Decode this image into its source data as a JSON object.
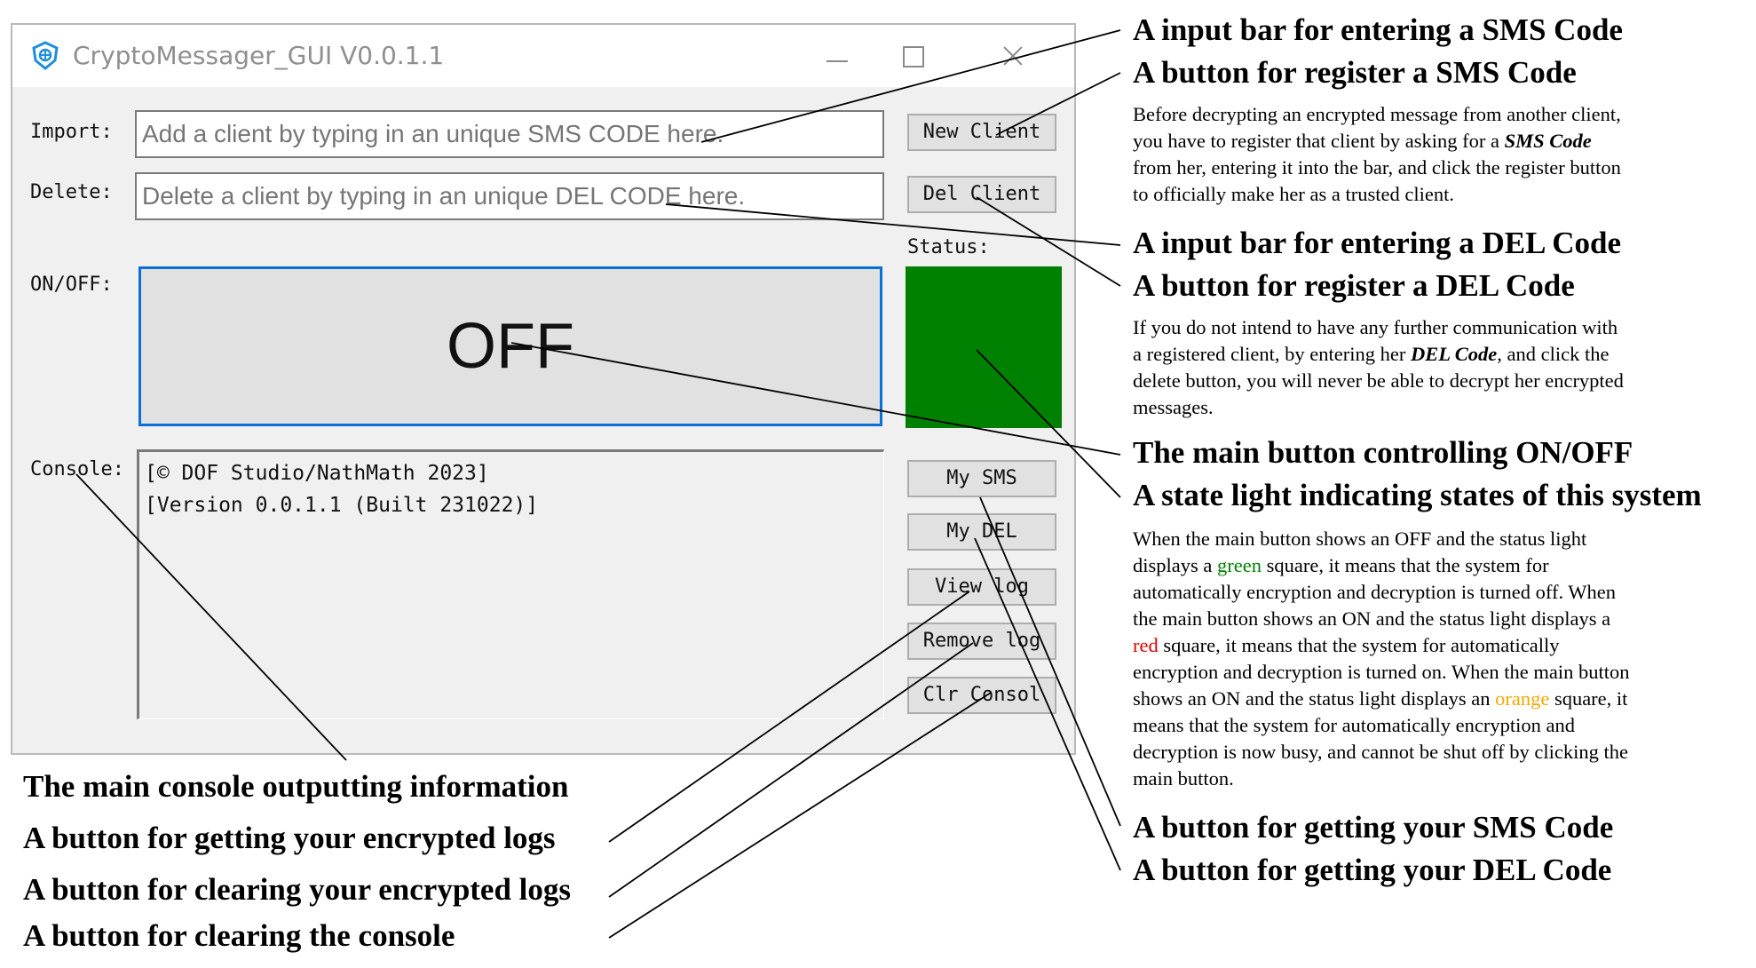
{
  "window": {
    "title": "CryptoMessager_GUI V0.0.1.1",
    "controls": [
      "minimize",
      "maximize",
      "close"
    ]
  },
  "form": {
    "import_label": "Import:",
    "import_placeholder": "Add a client by typing in an unique SMS CODE here.",
    "delete_label": "Delete:",
    "delete_placeholder": "Delete a client by typing in an unique DEL CODE here.",
    "onoff_label": "ON/OFF:",
    "main_button_text": "OFF",
    "status_label": "Status:",
    "status_color": "#008000",
    "console_label": "Console:",
    "console_lines": [
      "[© DOF Studio/NathMath 2023]",
      "[Version 0.0.1.1 (Built 231022)]"
    ]
  },
  "buttons": {
    "new_client": "New Client",
    "del_client": "Del Client",
    "my_sms": "My SMS",
    "my_del": "My DEL",
    "view_log": "View log",
    "remove_log": "Remove log",
    "clr_console": "Clr Consol"
  },
  "annotations": {
    "sms_input": "A input bar for entering a SMS Code",
    "sms_button": "A button for register a SMS Code",
    "sms_desc": {
      "before": "Before decrypting an encrypted message from another client, you have to register that client by asking for a ",
      "emph": "SMS Code",
      "after": " from her, entering it into the bar, and click the register button to officially make her as a trusted client."
    },
    "del_input": "A input bar for entering a DEL Code",
    "del_button": "A button for register a DEL Code",
    "del_desc": {
      "before": "If you do not intend to have any further communication with a registered client, by entering her ",
      "emph": "DEL Code",
      "after": ", and click the delete button, you will never be able to decrypt her encrypted messages."
    },
    "main_button": "The main button controlling ON/OFF",
    "state_light": "A state light indicating states of this system",
    "state_desc": {
      "p1": "When the main button shows an OFF and the status light displays a ",
      "green": "green",
      "p2": " square, it means that the system for automatically encryption and decryption is turned off. When the main button shows an ON and the status light displays a ",
      "red": "red",
      "p3": " square, it means that the system for automatically encryption and decryption is turned on. When the main button shows an ON and the status light displays an ",
      "orange": "orange",
      "p4": " square, it means that the system for automatically encryption and decryption is now busy, and cannot be shut off by clicking the main button."
    },
    "get_sms": "A button for getting your SMS Code",
    "get_del": "A button for getting your DEL Code",
    "console": "The main console outputting information",
    "get_logs": "A button for getting your encrypted logs",
    "clear_logs": "A button for clearing your encrypted logs",
    "clear_console": "A button for clearing the console"
  },
  "colors": {
    "status_green": "#008000",
    "main_button_border": "#0a6fd6",
    "annotation_green": "#008000",
    "annotation_red": "#e00000",
    "annotation_orange": "#f0a800"
  }
}
